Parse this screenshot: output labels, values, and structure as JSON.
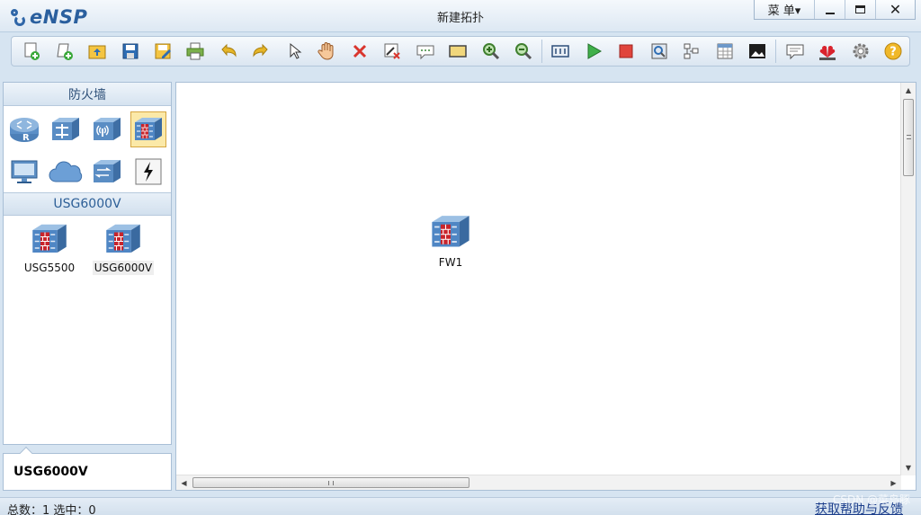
{
  "app": {
    "logo_text": "eNSP",
    "window_title": "新建拓扑",
    "menu_label": "菜 单▾"
  },
  "toolbar": {
    "buttons": [
      {
        "icon": "new-topology-icon"
      },
      {
        "icon": "new-testing-icon"
      },
      {
        "icon": "open-icon"
      },
      {
        "icon": "save-icon"
      },
      {
        "icon": "save-as-icon"
      },
      {
        "icon": "print-icon"
      },
      {
        "icon": "undo-icon"
      },
      {
        "icon": "redo-icon"
      },
      {
        "icon": "select-icon"
      },
      {
        "icon": "hand-icon"
      },
      {
        "icon": "delete-icon"
      },
      {
        "icon": "delete-link-icon"
      },
      {
        "icon": "text-icon"
      },
      {
        "icon": "rectangle-icon"
      },
      {
        "icon": "zoom-in-icon"
      },
      {
        "icon": "zoom-out-icon"
      },
      {
        "icon": "fit-icon"
      },
      {
        "icon": "start-icon"
      },
      {
        "icon": "stop-icon"
      },
      {
        "icon": "capture-icon"
      },
      {
        "icon": "topology-icon"
      },
      {
        "icon": "grid-icon"
      },
      {
        "icon": "screenshot-icon"
      },
      {
        "icon": "forum-icon"
      },
      {
        "icon": "huawei-icon"
      },
      {
        "icon": "settings-icon"
      },
      {
        "icon": "help-icon"
      }
    ]
  },
  "left_panel": {
    "category_title": "防火墙",
    "categories": [
      {
        "icon": "router-icon"
      },
      {
        "icon": "switch-icon"
      },
      {
        "icon": "wlan-icon"
      },
      {
        "icon": "firewall-icon"
      },
      {
        "icon": "pc-icon"
      },
      {
        "icon": "cloud-icon"
      },
      {
        "icon": "other-device-icon"
      },
      {
        "icon": "cable-icon"
      }
    ],
    "model_title": "USG6000V",
    "devices": [
      {
        "label": "USG5500"
      },
      {
        "label": "USG6000V"
      }
    ],
    "description": "USG6000V"
  },
  "canvas": {
    "nodes": [
      {
        "label": "FW1",
        "icon": "firewall-icon"
      }
    ]
  },
  "status": {
    "text": "总数：1 选中：0",
    "help_link": "获取帮助与反馈",
    "watermark": "CSDN @菜鸟豚"
  },
  "colors": {
    "accent": "#2a5f9e",
    "firewall_red": "#c8242b",
    "firewall_blue": "#4f86c4"
  }
}
